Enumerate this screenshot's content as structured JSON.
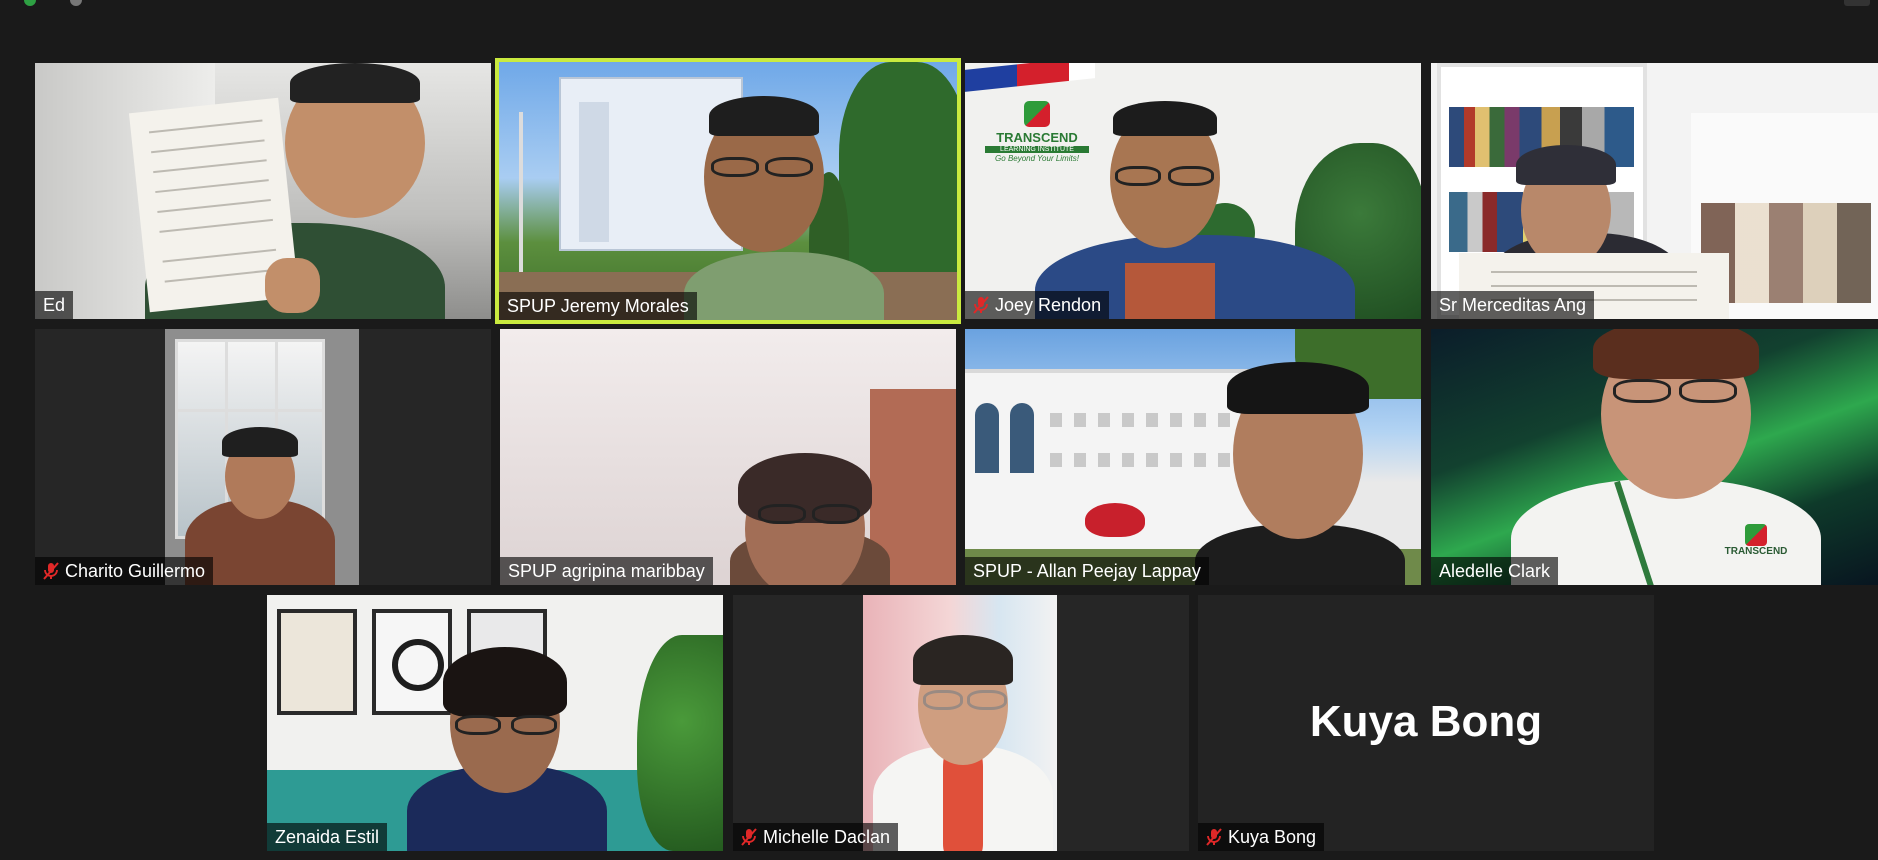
{
  "window": {
    "menu_label": ""
  },
  "participants": [
    {
      "name": "Ed",
      "muted": false,
      "active": false
    },
    {
      "name": "SPUP Jeremy Morales",
      "muted": false,
      "active": true
    },
    {
      "name": "Joey Rendon",
      "muted": true,
      "active": false
    },
    {
      "name": "Sr Merceditas Ang",
      "muted": false,
      "active": false
    },
    {
      "name": "Charito Guillermo",
      "muted": true,
      "active": false
    },
    {
      "name": "SPUP agripina maribbay",
      "muted": false,
      "active": false
    },
    {
      "name": "SPUP - Allan Peejay Lappay",
      "muted": false,
      "active": false
    },
    {
      "name": "Aledelle Clark",
      "muted": false,
      "active": false
    },
    {
      "name": "Zenaida Estil",
      "muted": false,
      "active": false
    },
    {
      "name": "Michelle Daclan",
      "muted": true,
      "active": false
    },
    {
      "name": "Kuya Bong",
      "muted": true,
      "active": false,
      "video_off": true,
      "display_name": "Kuya Bong"
    }
  ],
  "backgrounds": {
    "transcend_logo": "TRANSCEND",
    "transcend_sub": "LEARNING INSTITUTE",
    "transcend_tag": "Go Beyond Your Limits!",
    "shirt_logo": "TRANSCEND"
  },
  "colors": {
    "active_border": "#c9ea3f",
    "mute_red": "#e02828",
    "background": "#1a1a1a"
  },
  "icons": {
    "mute": "microphone-muted-icon"
  }
}
